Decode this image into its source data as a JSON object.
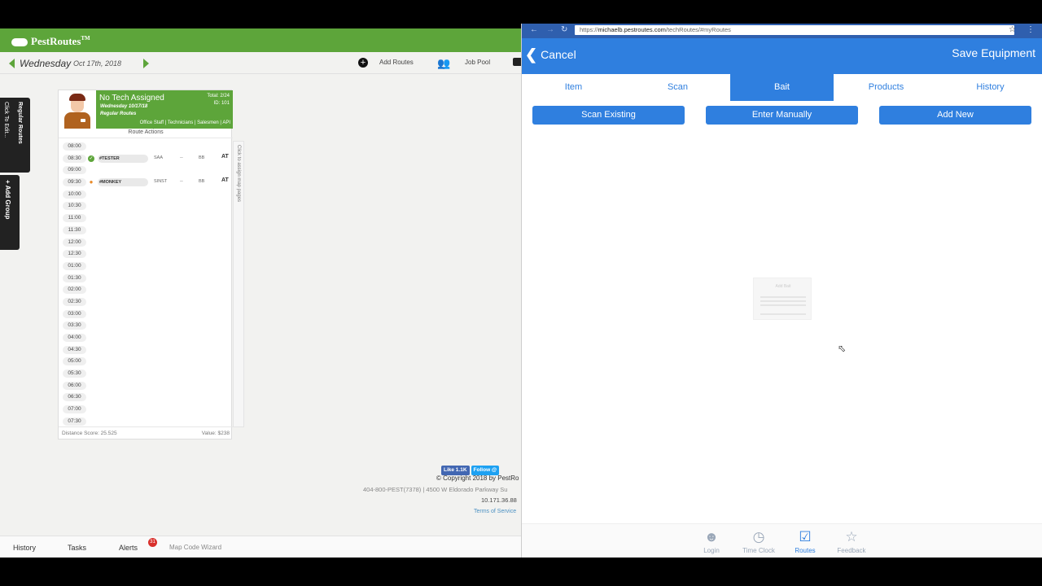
{
  "left_app": {
    "brand": "PestRoutes",
    "trademark": "TM",
    "day_name": "Wednesday",
    "day_date": "Oct 17th, 2018",
    "add_routes_label": "Add Routes",
    "job_pool_label": "Job Pool",
    "vtab_regular_routes": "Regular Routes",
    "vtab_click_to_edit": "Click To Edit...",
    "vtab_add_group": "+ Add Group",
    "route_card": {
      "tech_name": "No Tech Assigned",
      "date": "Wednesday 10/17/18",
      "group": "Regular Routes",
      "total": "Total: 2/24",
      "id": "ID: 101",
      "roles": "Office Staff | Technicians | Salesmen | API",
      "route_actions": "Route Actions",
      "times": [
        "08:00",
        "08:30",
        "09:00",
        "09:30",
        "10:00",
        "10:30",
        "11:00",
        "11:30",
        "12:00",
        "12:30",
        "01:00",
        "01:30",
        "02:00",
        "02:30",
        "03:00",
        "03:30",
        "04:00",
        "04:30",
        "05:00",
        "05:30",
        "06:00",
        "06:30",
        "07:00",
        "07:30"
      ],
      "appointments": [
        {
          "slot_time": "08:30",
          "name": "#TESTER",
          "code": "SAA",
          "dash": "--",
          "type": "BB",
          "at": "AT"
        },
        {
          "slot_time": "09:30",
          "name": "#MONKEY",
          "code": "SINST",
          "dash": "--",
          "type": "BB",
          "at": "AT"
        }
      ],
      "distance_score": "Distance Score: 25.525",
      "value": "Value: $238",
      "side_handle": "Click to assign map pages"
    },
    "footer": {
      "fb_like": "Like 1.1K",
      "tw_follow": "Follow @",
      "copyright": "© Copyright 2018 by PestRo",
      "address": "404-800-PEST(7378) | 4500 W Eldorado Parkway Su",
      "ip": "10.171.36.88",
      "terms": "Terms of Service"
    },
    "bottom_nav": {
      "history": "History",
      "tasks": "Tasks",
      "alerts": "Alerts",
      "alerts_count": "31",
      "map_code_wizard": "Map Code Wizard"
    }
  },
  "right_app": {
    "url_scheme": "https://",
    "url_host": "michaelb.pestroutes.com",
    "url_path": "/techRoutes/#myRoutes",
    "cancel_label": "Cancel",
    "save_label": "Save Equipment",
    "tabs": [
      {
        "label": "Item",
        "active": false
      },
      {
        "label": "Scan",
        "active": false
      },
      {
        "label": "Bait",
        "active": true
      },
      {
        "label": "Products",
        "active": false
      },
      {
        "label": "History",
        "active": false
      }
    ],
    "actions": {
      "scan_existing": "Scan Existing",
      "enter_manually": "Enter Manually",
      "add_new": "Add New"
    },
    "popup_title": "Add Bait",
    "tabbar": [
      {
        "label": "Login",
        "icon": "person-icon"
      },
      {
        "label": "Time Clock",
        "icon": "clock-icon"
      },
      {
        "label": "Routes",
        "icon": "clipboard-check-icon",
        "active": true
      },
      {
        "label": "Feedback",
        "icon": "star-icon"
      }
    ]
  },
  "colors": {
    "brand_green": "#5da53a",
    "app_blue": "#2f7fdf",
    "alert_red": "#d9302c"
  }
}
